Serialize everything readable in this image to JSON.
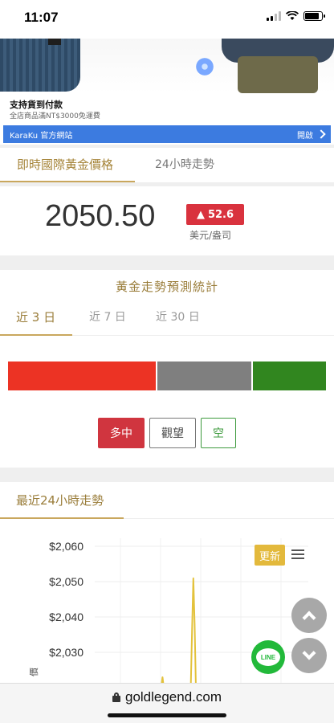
{
  "status": {
    "time": "11:07"
  },
  "ad": {
    "title": "支持貨到付款",
    "subtitle": "全店商品滿NT$3000免運費",
    "brand": "KaraKu 官方網站",
    "open_label": "開啟"
  },
  "main_tabs": [
    {
      "label": "即時國際黃金價格",
      "active": true
    },
    {
      "label": "24小時走勢",
      "active": false
    }
  ],
  "price": {
    "value": "2050.50",
    "change": "52.6",
    "change_direction": "up",
    "unit": "美元/盎司",
    "up_color": "#d9323e"
  },
  "forecast": {
    "title": "黃金走勢預測統計",
    "tabs": [
      {
        "label": "近 3 日",
        "active": true
      },
      {
        "label": "近 7 日",
        "active": false
      },
      {
        "label": "近 30 日",
        "active": false
      }
    ],
    "ratio": [
      {
        "name": "long",
        "fraction": 0.47,
        "color": "#ec3324"
      },
      {
        "name": "hold",
        "fraction": 0.3,
        "color": "#7f7f7f"
      },
      {
        "name": "short",
        "fraction": 0.23,
        "color": "#31861f"
      }
    ],
    "buttons": {
      "long": "多中",
      "hold": "觀望",
      "short": "空"
    }
  },
  "trend": {
    "title": "最近24小時走勢",
    "update_label": "更新",
    "chart_data": {
      "type": "line",
      "y_ticks": [
        "$2,060",
        "$2,050",
        "$2,040",
        "$2,030"
      ],
      "ylim": [
        2020,
        2060
      ],
      "ylabel": "價",
      "xlabel": "",
      "grid": true,
      "series_color": "#e3c23c",
      "x": [
        0.0,
        0.33,
        0.34,
        0.35,
        0.56,
        0.57,
        0.58,
        0.59,
        0.6
      ],
      "values": [
        2020,
        2020,
        2023,
        2020,
        2020,
        2036,
        2051,
        2038,
        2020
      ]
    }
  },
  "fab": {
    "line_label": "LINE"
  },
  "urlbar": {
    "domain": "goldlegend.com"
  }
}
